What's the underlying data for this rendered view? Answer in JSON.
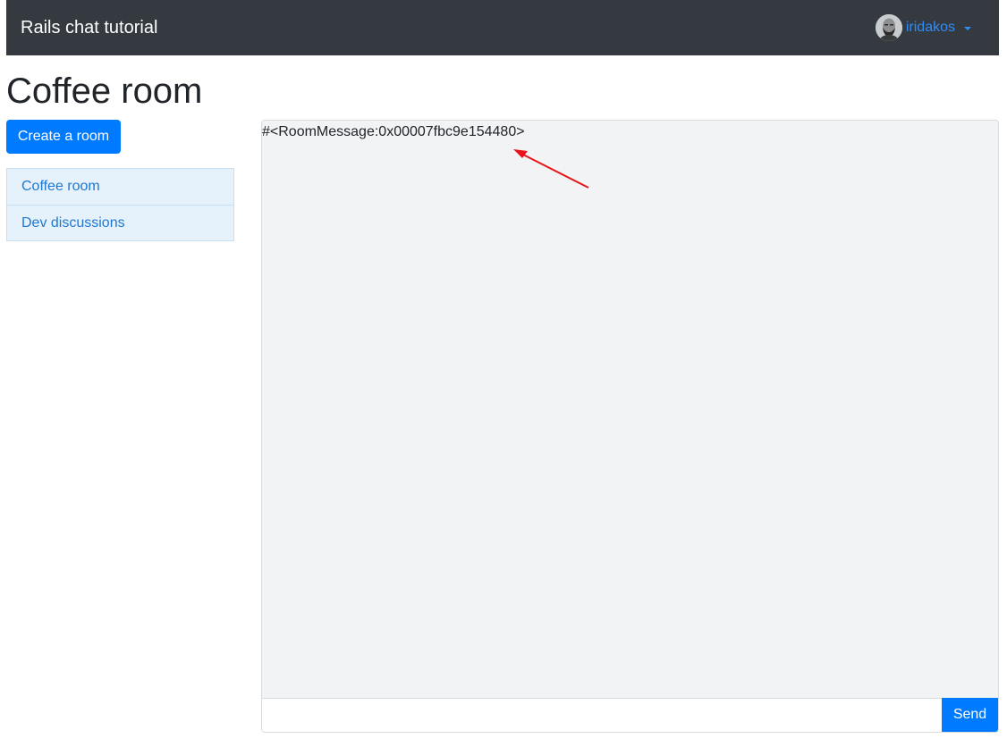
{
  "navbar": {
    "brand": "Rails chat tutorial",
    "user": {
      "name": "iridakos",
      "avatar_icon": "user-avatar",
      "dropdown_icon": "caret-down-icon"
    }
  },
  "page": {
    "title": "Coffee room"
  },
  "sidebar": {
    "create_button": "Create a room",
    "rooms": [
      {
        "label": "Coffee room"
      },
      {
        "label": "Dev discussions"
      }
    ]
  },
  "chat": {
    "messages": [
      {
        "text": "#<RoomMessage:0x00007fbc9e154480>"
      }
    ],
    "input": {
      "value": "",
      "placeholder": ""
    },
    "send_label": "Send"
  },
  "colors": {
    "navbar_bg": "#343a40",
    "primary": "#007bff",
    "link": "#1f78d1",
    "annotation_arrow": "#e8141b",
    "chat_bg": "#f2f3f5",
    "list_bg": "#e5f1fb"
  }
}
